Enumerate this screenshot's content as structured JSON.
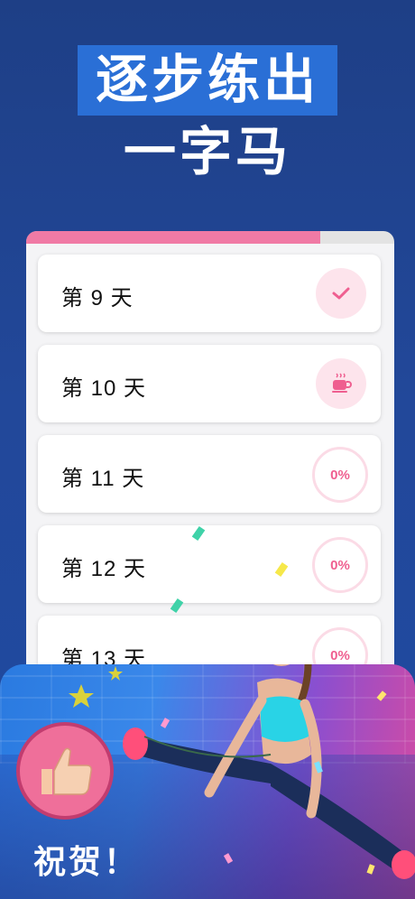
{
  "headline": {
    "line1": "逐步练出",
    "line2": "一字马"
  },
  "progress": {
    "fraction": 0.8
  },
  "days": [
    {
      "label": "第 9 天",
      "status": "done",
      "icon": "checkmark-icon"
    },
    {
      "label": "第 10 天",
      "status": "rest",
      "icon": "coffee-cup-icon"
    },
    {
      "label": "第 11 天",
      "status": "pending",
      "percent": "0%"
    },
    {
      "label": "第 12 天",
      "status": "pending",
      "percent": "0%"
    },
    {
      "label": "第 13 天",
      "status": "pending",
      "percent": "0%"
    }
  ],
  "celebration": {
    "text": "祝贺！",
    "icon": "thumbs-up-icon"
  },
  "colors": {
    "accent_pink": "#f07aa5",
    "background_blue": "#1e3f86",
    "banner_blue": "#2a6fd6"
  }
}
